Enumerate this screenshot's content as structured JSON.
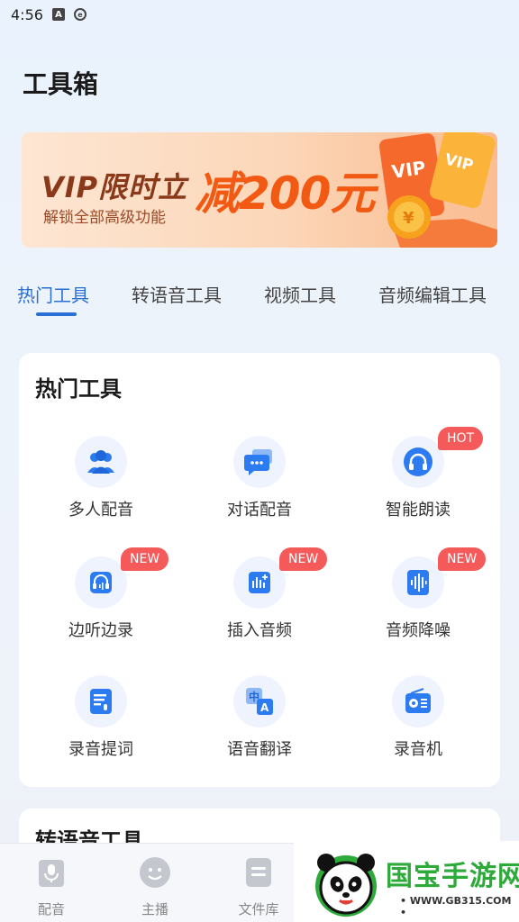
{
  "status_bar": {
    "time": "4:56",
    "icons": [
      "a-badge-icon",
      "e-circle-icon"
    ]
  },
  "page": {
    "title": "工具箱"
  },
  "banner": {
    "vip_text": "VIP限时立",
    "discount_text": "减200元",
    "sub_text": "解锁全部高级功能"
  },
  "tabs": [
    {
      "label": "热门工具",
      "active": true
    },
    {
      "label": "转语音工具",
      "active": false
    },
    {
      "label": "视频工具",
      "active": false
    },
    {
      "label": "音频编辑工具",
      "active": false
    }
  ],
  "hot_tools": {
    "title": "热门工具",
    "items": [
      {
        "label": "多人配音",
        "icon": "multi-person-icon",
        "badge": ""
      },
      {
        "label": "对话配音",
        "icon": "chat-bubbles-icon",
        "badge": ""
      },
      {
        "label": "智能朗读",
        "icon": "headphones-icon",
        "badge": "HOT"
      },
      {
        "label": "边听边录",
        "icon": "headset-record-icon",
        "badge": "NEW"
      },
      {
        "label": "插入音频",
        "icon": "insert-audio-icon",
        "badge": "NEW"
      },
      {
        "label": "音频降噪",
        "icon": "noise-reduction-icon",
        "badge": "NEW"
      },
      {
        "label": "录音提词",
        "icon": "teleprompter-icon",
        "badge": ""
      },
      {
        "label": "语音翻译",
        "icon": "translate-icon",
        "badge": ""
      },
      {
        "label": "录音机",
        "icon": "radio-recorder-icon",
        "badge": ""
      }
    ]
  },
  "speech_tools": {
    "title": "转语音工具"
  },
  "bottom_nav": [
    {
      "label": "配音",
      "icon": "mic-icon"
    },
    {
      "label": "主播",
      "icon": "face-icon"
    },
    {
      "label": "文件库",
      "icon": "file-icon"
    }
  ],
  "watermark": {
    "text": "国宝手游网",
    "url": "• WWW.GB315.COM •",
    "logo": "panda-logo-icon"
  },
  "colors": {
    "accent": "#2a6fd6",
    "badge": "#f55a5a",
    "icon_blue": "#2d7bf0",
    "discount": "#f25a14"
  }
}
